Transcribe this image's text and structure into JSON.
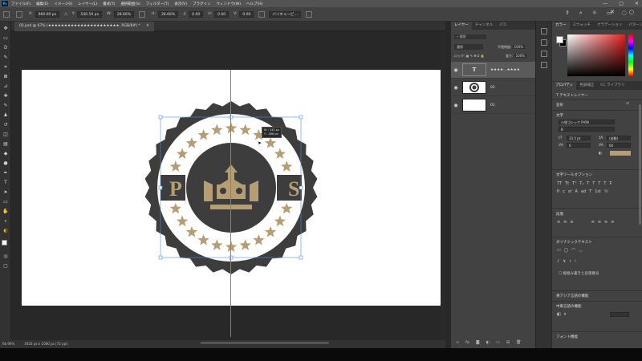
{
  "menu": {
    "app_logo": "Ps",
    "items": [
      "ファイル(F)",
      "編集(E)",
      "イメージ(I)",
      "レイヤー(L)",
      "書式(Y)",
      "選択範囲(S)",
      "フィルター(T)",
      "表示(V)",
      "プラグイン",
      "ウィンドウ(W)",
      "ヘルプ(H)"
    ]
  },
  "options_bar": {
    "x_label": "X:",
    "x_value": "960.00 px",
    "y_label": "Y:",
    "y_value": "540.50 px",
    "w_label": "W:",
    "w_value": "28.66%",
    "h_label": "H:",
    "h_value": "28.66%",
    "angle_value": "0.00",
    "h_skew_label": "H:",
    "h_skew_value": "0.00",
    "v_skew_label": "V:",
    "v_skew_value": "0.00",
    "interp_value": "バイキュービ…"
  },
  "document": {
    "tab_title": "02.psd @ 67% (★★★★★★★★★★★★★★★★★★★★★★, RGB/8#) *",
    "zoom": "66.96%",
    "doc_size": "1920 px x 1080 px (72 ppi)"
  },
  "transform_readout": {
    "w": "W : 142 px",
    "h": "Y : 486 px"
  },
  "layers_panel": {
    "tabs": [
      "レイヤー",
      "チャンネル",
      "パス"
    ],
    "search_placeholder": "種類",
    "blend_mode": "通常",
    "opacity_label": "不透明度:",
    "opacity_value": "100%",
    "lock_label": "ロック:",
    "fill_label": "塗り:",
    "fill_value": "100%",
    "layers": [
      {
        "name": "★★★★…★★★★",
        "type": "text",
        "thumb": "T"
      },
      {
        "name": "02",
        "type": "image",
        "thumb": ""
      },
      {
        "name": "01",
        "type": "image",
        "thumb": ""
      }
    ]
  },
  "color_panel": {
    "tabs": [
      "カラー",
      "スウォッチ",
      "グラデーション",
      "パターン"
    ],
    "foreground": "#ffffff",
    "background": "#000000"
  },
  "properties_panel": {
    "tabs": [
      "プロパティ",
      "色調補正",
      "CC ライブラリ"
    ],
    "layer_kind": "テキストレイヤー",
    "transform_header": "変形",
    "char_header": "文字",
    "font_family": "小塚ゴシック Pr6N",
    "font_style": "B",
    "font_size": "33.5 pt",
    "leading": "(自動)",
    "tracking": "0",
    "kerning": "60",
    "text_color": "#b59d74",
    "tools_header": "文字ツールオプション",
    "paragraph_header": "段落",
    "dynamic_header": "ダイナミックテキスト",
    "mix_label": "縦組み書きと段落番号",
    "asian_header": "東アジア言語の機能",
    "middle_header": "中東言語の機能",
    "more_header": "フォント機能"
  },
  "emblem": {
    "dark": "#3d3d3d",
    "gold": "#b59d74",
    "star_count": 26
  }
}
